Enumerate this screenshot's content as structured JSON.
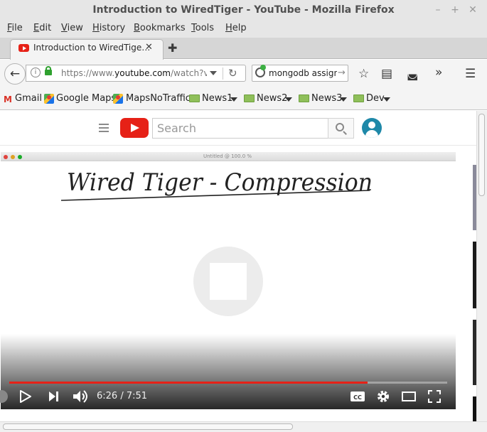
{
  "window": {
    "title": "Introduction to WiredTiger - YouTube - Mozilla Firefox",
    "controls": {
      "minimize": "–",
      "maximize": "+",
      "close": "✕"
    }
  },
  "menubar": {
    "items": [
      {
        "first": "F",
        "rest": "ile"
      },
      {
        "first": "E",
        "rest": "dit"
      },
      {
        "first": "V",
        "rest": "iew"
      },
      {
        "first": "H",
        "rest": "istory"
      },
      {
        "first": "B",
        "rest": "ookmarks"
      },
      {
        "first": "T",
        "rest": "ools"
      },
      {
        "first": "H",
        "rest": "elp"
      }
    ]
  },
  "tabs": {
    "active_title": "Introduction to WiredTige…",
    "close_glyph": "✕",
    "new_tab_glyph": "✚"
  },
  "navbar": {
    "back_glyph": "←",
    "info_glyph": "i",
    "url_prefix": "https://www.",
    "url_domain": "youtube.com",
    "url_suffix": "/watch?v=C",
    "reload_glyph": "↻",
    "search_value": "mongodb assign",
    "search_go_glyph": "→",
    "icons": {
      "bookmark": "☆",
      "reader": "▤",
      "pocket": "◛",
      "overflow": "»",
      "menu": "☰"
    }
  },
  "bookmarks": {
    "gmail_glyph": "M",
    "items": [
      "Gmail",
      "Google Maps",
      "MapsNoTraffic",
      "News1",
      "News2",
      "News3",
      "Dev"
    ]
  },
  "youtube": {
    "search_placeholder": "Search"
  },
  "video": {
    "doc_title": "Untitled @ 100.0 %",
    "handwritten_title": "Wired Tiger - Compression",
    "time_current": "6:26",
    "time_total": "7:51",
    "time_display": "6:26 / 7:51",
    "progress_fraction": 0.818,
    "cc_label": "CC",
    "mac_dot_colors": [
      "#e0443e",
      "#dea123",
      "#1aab29"
    ]
  }
}
